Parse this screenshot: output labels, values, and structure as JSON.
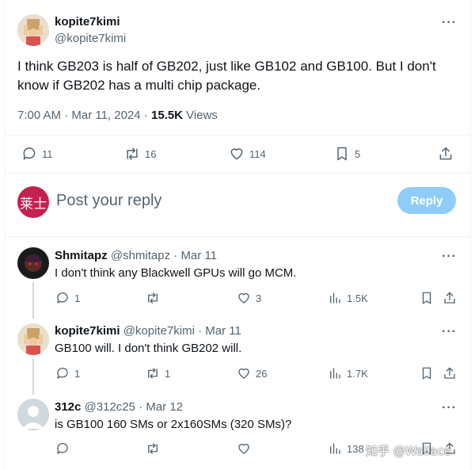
{
  "main_tweet": {
    "name": "kopite7kimi",
    "handle": "@kopite7kimi",
    "text": "I think GB203 is half of GB202, just like GB102 and GB100. But I don't know if GB202 has a multi chip package.",
    "time": "7:00 AM · Mar 11, 2024 · ",
    "views_count": "15.5K",
    "views_label": " Views",
    "more": "···",
    "actions": {
      "replies": "11",
      "retweets": "16",
      "likes": "114",
      "bookmarks": "5"
    }
  },
  "composer": {
    "avatar_text": "莱士",
    "placeholder": "Post your reply",
    "button": "Reply"
  },
  "replies": [
    {
      "name": "Shmitapz",
      "handle": "@shmitapz",
      "date": " · Mar 11",
      "text": "I don't think any Blackwell GPUs will go MCM.",
      "replies": "1",
      "retweets": "",
      "likes": "3",
      "views": "1.5K"
    },
    {
      "name": "kopite7kimi",
      "handle": "@kopite7kimi",
      "date": " · Mar 11",
      "text": "GB100 will. I don't think GB202 will.",
      "replies": "1",
      "retweets": "1",
      "likes": "26",
      "views": "1.7K"
    },
    {
      "name": "312c",
      "handle": "@312c25",
      "date": " · Mar 12",
      "text": "is GB100 160 SMs or 2x160SMs (320 SMs)?",
      "replies": "",
      "retweets": "",
      "likes": "",
      "views": "138"
    }
  ],
  "watermark": "知乎 @Wallace"
}
